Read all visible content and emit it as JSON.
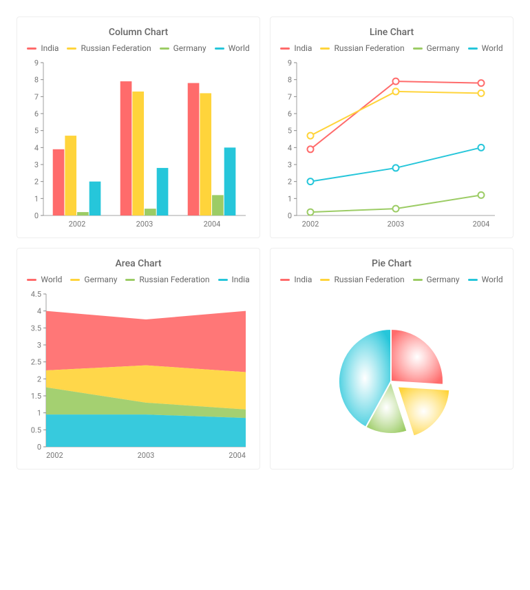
{
  "colors": {
    "india": "#ff6b6b",
    "russia": "#ffd43b",
    "germany": "#9ccc65",
    "world": "#26c6da"
  },
  "charts": {
    "column": {
      "title": "Column Chart",
      "legend": [
        "India",
        "Russian Federation",
        "Germany",
        "World"
      ]
    },
    "line": {
      "title": "Line Chart",
      "legend": [
        "India",
        "Russian Federation",
        "Germany",
        "World"
      ]
    },
    "area": {
      "title": "Area Chart",
      "legend": [
        "World",
        "Germany",
        "Russian Federation",
        "India"
      ]
    },
    "pie": {
      "title": "Pie Chart",
      "legend": [
        "India",
        "Russian Federation",
        "Germany",
        "World"
      ]
    }
  },
  "chart_data": [
    {
      "id": "column",
      "type": "bar",
      "title": "Column Chart",
      "categories": [
        "2002",
        "2003",
        "2004"
      ],
      "series": [
        {
          "name": "India",
          "values": [
            3.9,
            7.9,
            7.8
          ]
        },
        {
          "name": "Russian Federation",
          "values": [
            4.7,
            7.3,
            7.2
          ]
        },
        {
          "name": "Germany",
          "values": [
            0.2,
            0.4,
            1.2
          ]
        },
        {
          "name": "World",
          "values": [
            2.0,
            2.8,
            4.0
          ]
        }
      ],
      "ylabel": "",
      "xlabel": "",
      "ylim": [
        0,
        9
      ],
      "yticks": [
        0,
        1,
        2,
        3,
        4,
        5,
        6,
        7,
        8,
        9
      ]
    },
    {
      "id": "line",
      "type": "line",
      "title": "Line Chart",
      "categories": [
        "2002",
        "2003",
        "2004"
      ],
      "series": [
        {
          "name": "India",
          "values": [
            3.9,
            7.9,
            7.8
          ]
        },
        {
          "name": "Russian Federation",
          "values": [
            4.7,
            7.3,
            7.2
          ]
        },
        {
          "name": "Germany",
          "values": [
            0.2,
            0.4,
            1.2
          ]
        },
        {
          "name": "World",
          "values": [
            2.0,
            2.8,
            4.0
          ]
        }
      ],
      "ylabel": "",
      "xlabel": "",
      "ylim": [
        0,
        9
      ],
      "yticks": [
        0,
        1,
        2,
        3,
        4,
        5,
        6,
        7,
        8,
        9
      ]
    },
    {
      "id": "area",
      "type": "area",
      "title": "Area Chart",
      "categories": [
        "2002",
        "2003",
        "2004"
      ],
      "series_stack_order_bottom_to_top": [
        "India",
        "Russian Federation",
        "Germany",
        "World"
      ],
      "series": [
        {
          "name": "India",
          "values": [
            0.95,
            0.95,
            0.85
          ]
        },
        {
          "name": "Russian Federation",
          "values": [
            0.8,
            0.35,
            0.25
          ]
        },
        {
          "name": "Germany",
          "values": [
            0.5,
            1.1,
            1.1
          ]
        },
        {
          "name": "World",
          "values": [
            1.75,
            1.35,
            1.8
          ]
        }
      ],
      "ylabel": "",
      "xlabel": "",
      "ylim": [
        0,
        4.5
      ],
      "yticks": [
        0,
        0.5,
        1,
        1.5,
        2,
        2.5,
        3,
        3.5,
        4,
        4.5
      ]
    },
    {
      "id": "pie",
      "type": "pie",
      "title": "Pie Chart",
      "slices": [
        {
          "name": "India",
          "value": 26
        },
        {
          "name": "Russian Federation",
          "value": 19
        },
        {
          "name": "Germany",
          "value": 13
        },
        {
          "name": "World",
          "value": 42
        }
      ],
      "exploded": "Russian Federation"
    }
  ]
}
